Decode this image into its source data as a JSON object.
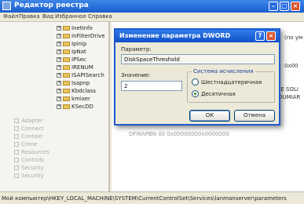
{
  "window": {
    "title": "Редактор реестра",
    "menu": [
      "Файл",
      "Правка",
      "Вид",
      "Избранное",
      "Справка"
    ]
  },
  "tree": {
    "items": [
      {
        "label": "InetInfo"
      },
      {
        "label": "InFilterDrive"
      },
      {
        "label": "Ipinip"
      },
      {
        "label": "IpNat"
      },
      {
        "label": "IPSec"
      },
      {
        "label": "IRENUM"
      },
      {
        "label": "ISAPISearch"
      },
      {
        "label": "Isapnp"
      },
      {
        "label": "Kbdclass"
      },
      {
        "label": "kmixer"
      },
      {
        "label": "KSecDD"
      }
    ],
    "faded": [
      "Adapter",
      "Connect",
      "Context",
      "Cmne",
      "Resources",
      "Controls",
      "Security",
      "Security"
    ]
  },
  "values_pane": {
    "rows": [
      "(по ум",
      "0x00",
      "DE SOLI",
      "DUMIAR",
      "DFWAPBN 00 0x0000000",
      "0x0000000"
    ]
  },
  "statusbar": {
    "path": "Мой компьютер\\HKEY_LOCAL_MACHINE\\SYSTEM\\CurrentControlSet\\Services\\lanmanserver\\parameters"
  },
  "dialog": {
    "title": "Изменение параметра DWORD",
    "help": "?",
    "close": "×",
    "name_label": "Параметр:",
    "name_value": "DiskSpaceThreshold",
    "value_label": "Значение:",
    "value_value": "2",
    "base_group": "Система исчисления",
    "radio_hex": "Шестнадцатеричная",
    "radio_dec": "Десятичная",
    "ok": "ОК",
    "cancel": "Отмена"
  }
}
